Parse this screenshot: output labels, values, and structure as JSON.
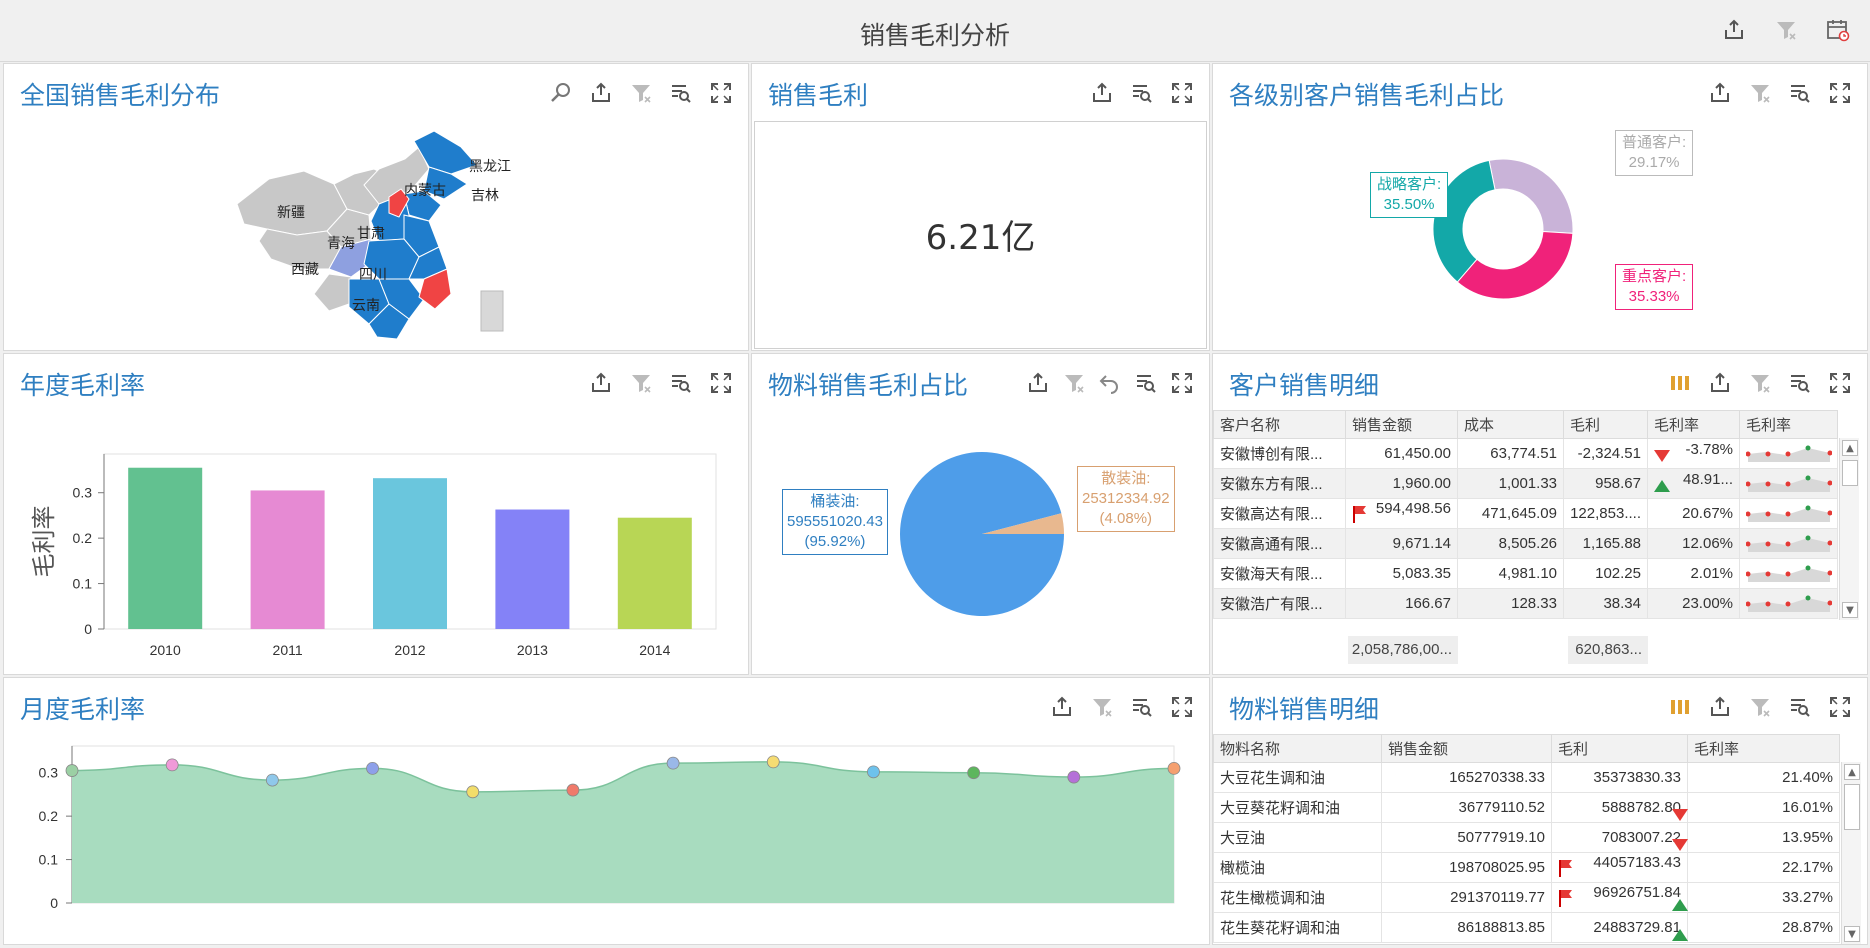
{
  "page": {
    "title": "销售毛利分析"
  },
  "map_panel": {
    "title": "全国销售毛利分布",
    "provinces": [
      "黑龙江",
      "吉林",
      "内蒙古",
      "新疆",
      "甘肃",
      "青海",
      "西藏",
      "四川",
      "云南"
    ]
  },
  "kpi_panel": {
    "title": "销售毛利",
    "value": "6.21亿"
  },
  "donut_panel": {
    "title": "各级别客户销售毛利占比",
    "slices": [
      {
        "name": "战略客户:",
        "pct": "35.50%",
        "value": 35.5,
        "color": "#13a8a8"
      },
      {
        "name": "重点客户:",
        "pct": "35.33%",
        "value": 35.33,
        "color": "#f0227a"
      },
      {
        "name": "普通客户:",
        "pct": "29.17%",
        "value": 29.17,
        "color": "#c9b3d8"
      }
    ]
  },
  "bar_panel": {
    "title": "年度毛利率"
  },
  "pie_panel": {
    "title": "物料销售毛利占比",
    "slices": [
      {
        "name": "桶装油:",
        "amount": "595551020.43",
        "pct": "(95.92%)",
        "value": 95.92,
        "color": "#4e9de9"
      },
      {
        "name": "散装油:",
        "amount": "25312334.92",
        "pct": "(4.08%)",
        "value": 4.08,
        "color": "#e8b88f"
      }
    ]
  },
  "customer_panel": {
    "title": "客户销售明细",
    "columns": [
      "客户名称",
      "销售金额",
      "成本",
      "毛利",
      "毛利率",
      "毛利率"
    ],
    "rows": [
      {
        "name": "安徽博创有限...",
        "sales": "61,450.00",
        "cost": "63,774.51",
        "profit": "-2,324.51",
        "rate": "-3.78%",
        "mark": "down"
      },
      {
        "name": "安徽东方有限...",
        "sales": "1,960.00",
        "cost": "1,001.33",
        "profit": "958.67",
        "rate": "48.91...",
        "mark": "up"
      },
      {
        "name": "安徽高达有限...",
        "sales": "594,498.56",
        "cost": "471,645.09",
        "profit": "122,853....",
        "rate": "20.67%",
        "mark": "flag"
      },
      {
        "name": "安徽高通有限...",
        "sales": "9,671.14",
        "cost": "8,505.26",
        "profit": "1,165.88",
        "rate": "12.06%",
        "mark": ""
      },
      {
        "name": "安徽海天有限...",
        "sales": "5,083.35",
        "cost": "4,981.10",
        "profit": "102.25",
        "rate": "2.01%",
        "mark": ""
      },
      {
        "name": "安徽浩广有限...",
        "sales": "166.67",
        "cost": "128.33",
        "profit": "38.34",
        "rate": "23.00%",
        "mark": ""
      }
    ],
    "totals": {
      "sales": "2,058,786,00...",
      "profit": "620,863..."
    }
  },
  "line_panel": {
    "title": "月度毛利率"
  },
  "material_panel": {
    "title": "物料销售明细",
    "columns": [
      "物料名称",
      "销售金额",
      "毛利",
      "毛利率"
    ],
    "rows": [
      {
        "name": "大豆花生调和油",
        "sales": "165270338.33",
        "profit": "35373830.33",
        "rate": "21.40%",
        "mark": ""
      },
      {
        "name": "大豆葵花籽调和油",
        "sales": "36779110.52",
        "profit": "5888782.80",
        "rate": "16.01%",
        "mark": "down"
      },
      {
        "name": "大豆油",
        "sales": "50777919.10",
        "profit": "7083007.22",
        "rate": "13.95%",
        "mark": "down"
      },
      {
        "name": "橄榄油",
        "sales": "198708025.95",
        "profit": "44057183.43",
        "rate": "22.17%",
        "mark": "flag"
      },
      {
        "name": "花生橄榄调和油",
        "sales": "291370119.77",
        "profit": "96926751.84",
        "rate": "33.27%",
        "mark": "flagup"
      },
      {
        "name": "花生葵花籽调和油",
        "sales": "86188813.85",
        "profit": "24883729.81",
        "rate": "28.87%",
        "mark": "up"
      }
    ]
  },
  "chart_data": [
    {
      "type": "bar",
      "title": "年度毛利率",
      "ylabel": "毛利率",
      "categories": [
        "2010",
        "2011",
        "2012",
        "2013",
        "2014"
      ],
      "values": [
        0.355,
        0.305,
        0.332,
        0.263,
        0.245
      ],
      "colors": [
        "#62c190",
        "#e68ad3",
        "#6ac6dd",
        "#8482f7",
        "#b8d655"
      ],
      "ylim": [
        0,
        0.35
      ],
      "yticks": [
        "0",
        "0.1",
        "0.2",
        "0.3"
      ]
    },
    {
      "type": "area",
      "title": "月度毛利率",
      "values": [
        0.305,
        0.318,
        0.283,
        0.31,
        0.256,
        0.26,
        0.322,
        0.325,
        0.302,
        0.3,
        0.29,
        0.31
      ],
      "point_colors": [
        "#9bd0a4",
        "#f09ad8",
        "#8fc8ea",
        "#8ea0ea",
        "#f2dd6a",
        "#f07a6a",
        "#9ab8e8",
        "#f6dc72",
        "#6ec2ec",
        "#5db65d",
        "#b570d8",
        "#f5a070"
      ],
      "ylim": [
        0,
        0.35
      ],
      "yticks": [
        "0",
        "0.1",
        "0.2",
        "0.3"
      ]
    }
  ],
  "colors": {
    "accent": "#2f7fc1",
    "map_blue": "#1f7dcc",
    "map_red": "#f04444",
    "map_gray": "#c8c8c8"
  },
  "icons": [
    "export-icon",
    "filter-clear-icon",
    "calendar-clear-icon",
    "zoom-icon",
    "filter-search-icon",
    "fullscreen-icon",
    "undo-icon",
    "columns-icon"
  ]
}
